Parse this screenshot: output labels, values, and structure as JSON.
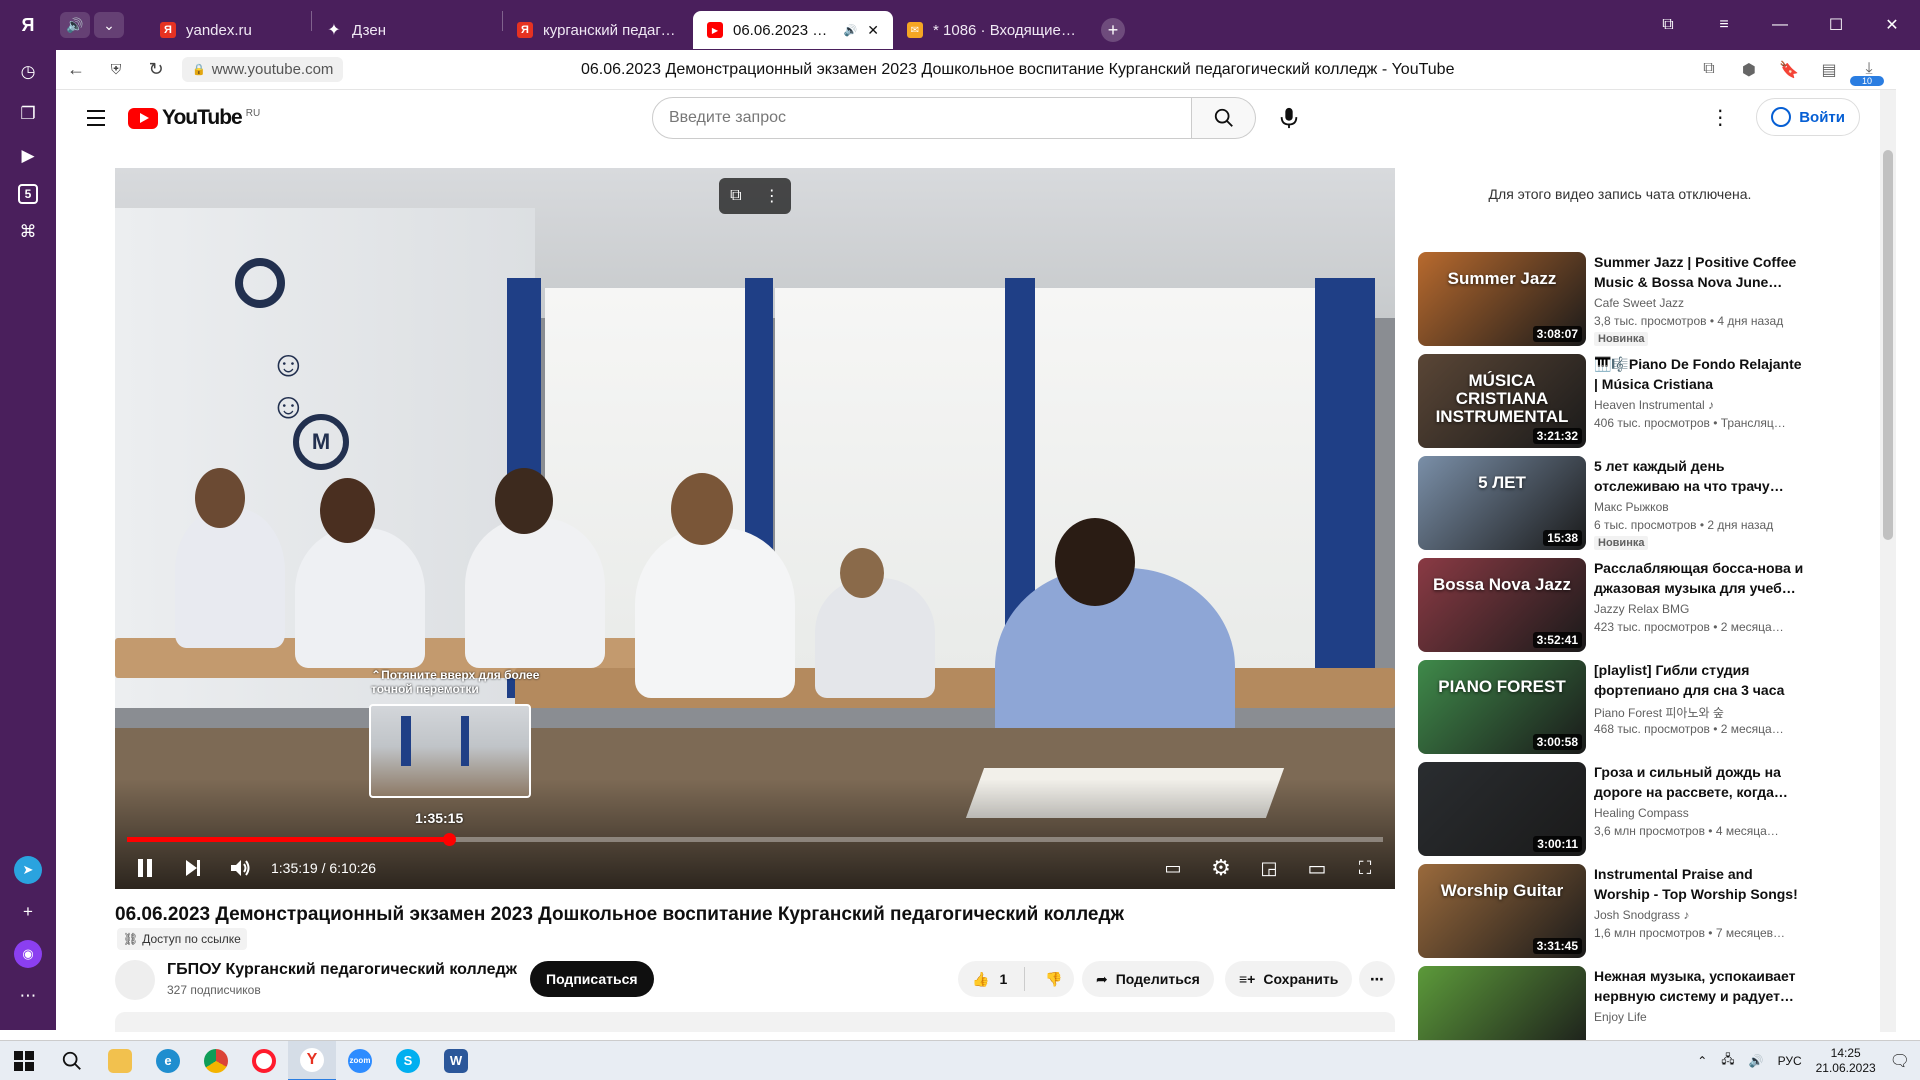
{
  "browser": {
    "tabs": [
      {
        "label": "yandex.ru",
        "favicon_color": "#e63222",
        "favicon_glyph": "Я"
      },
      {
        "label": "Дзен",
        "favicon_color": "#222222",
        "favicon_glyph": "✦"
      },
      {
        "label": "курганский педагогическ",
        "favicon_color": "#e63222",
        "favicon_glyph": "Я"
      },
      {
        "label": "06.06.2023 Демонстр",
        "favicon_color": "#ff0000",
        "favicon_glyph": "▶",
        "active": true
      },
      {
        "label": "* 1086 · Входящие — Янде",
        "favicon_color": "#f5a623",
        "favicon_glyph": "✉"
      }
    ],
    "url": "www.youtube.com",
    "page_title": "06.06.2023 Демонстрационный экзамен 2023 Дошкольное воспитание Курганский педагогический колледж - YouTube",
    "download_count": "10"
  },
  "youtube": {
    "logo_text": "YouTube",
    "country_code": "RU",
    "search_placeholder": "Введите запрос",
    "signin_label": "Войти"
  },
  "player": {
    "seek_hint": "Потяните вверх для более точной перемотки",
    "seek_preview_time": "1:35:15",
    "current_time": "1:35:19",
    "duration": "6:10:26",
    "time_display": "1:35:19 / 6:10:26",
    "progress_fraction": 0.2567
  },
  "video": {
    "title": "06.06.2023 Демонстрационный экзамен 2023 Дошкольное воспитание Курганский педагогический колледж",
    "access": "Доступ по ссылке",
    "channel_name": "ГБПОУ Курганский педагогический колледж",
    "subscribers": "327 подписчиков",
    "subscribe_label": "Подписаться",
    "likes": "1",
    "share_label": "Поделиться",
    "save_label": "Сохранить"
  },
  "chat_disabled": "Для этого видео запись чата отключена.",
  "recommendations": [
    {
      "title": "Summer Jazz | Positive Coffee Music & Bossa Nova June…",
      "channel": "Cafe Sweet Jazz",
      "meta": "3,8 тыс. просмотров • 4 дня назад",
      "duration": "3:08:07",
      "badge": "Новинка",
      "thumb_text": "Summer Jazz",
      "thumb_color": "#b86a2e"
    },
    {
      "title": "🎹🎼Piano De Fondo Relajante | Música Cristiana Instrumenta…",
      "channel": "Heaven Instrumental ♪",
      "meta": "406 тыс. просмотров • Трансляц…",
      "duration": "3:21:32",
      "badge": "",
      "thumb_text": "MÚSICA CRISTIANA INSTRUMENTAL",
      "thumb_color": "#5a4636"
    },
    {
      "title": "5 лет каждый день отслеживаю на что трачу…",
      "channel": "Макс Рыжков",
      "meta": "6 тыс. просмотров • 2 дня назад",
      "duration": "15:38",
      "badge": "Новинка",
      "thumb_text": "5 ЛЕТ",
      "thumb_color": "#7a8fa8"
    },
    {
      "title": "Расслабляющая босса-нова и джазовая музыка для учеб…",
      "channel": "Jazzy Relax BMG",
      "meta": "423 тыс. просмотров • 2 месяца…",
      "duration": "3:52:41",
      "badge": "",
      "thumb_text": "Bossa Nova Jazz",
      "thumb_color": "#8a3a44"
    },
    {
      "title": "[playlist] Гибли студия фортепиано для сна 3 часа /…",
      "channel": "Piano Forest 피아노와 숲",
      "meta": "468 тыс. просмотров • 2 месяца…",
      "duration": "3:00:58",
      "badge": "",
      "thumb_text": "PIANO FOREST",
      "thumb_color": "#3f8a4a"
    },
    {
      "title": "Гроза и сильный дождь на дороге на рассвете, когда…",
      "channel": "Healing Compass",
      "meta": "3,6 млн просмотров • 4 месяца…",
      "duration": "3:00:11",
      "badge": "",
      "thumb_text": "",
      "thumb_color": "#2a2d30"
    },
    {
      "title": "Instrumental Praise and Worship - Top Worship Songs!",
      "channel": "Josh Snodgrass ♪",
      "meta": "1,6 млн просмотров • 7 месяцев…",
      "duration": "3:31:45",
      "badge": "",
      "thumb_text": "Worship Guitar",
      "thumb_color": "#9a6a3c"
    },
    {
      "title": "Нежная музыка, успокаивает нервную систему и радует…",
      "channel": "Enjoy Life",
      "meta": "",
      "duration": "",
      "badge": "",
      "thumb_text": "",
      "thumb_color": "#5c9a3a"
    }
  ],
  "taskbar": {
    "language": "РУС",
    "time": "14:25",
    "date": "21.06.2023"
  }
}
